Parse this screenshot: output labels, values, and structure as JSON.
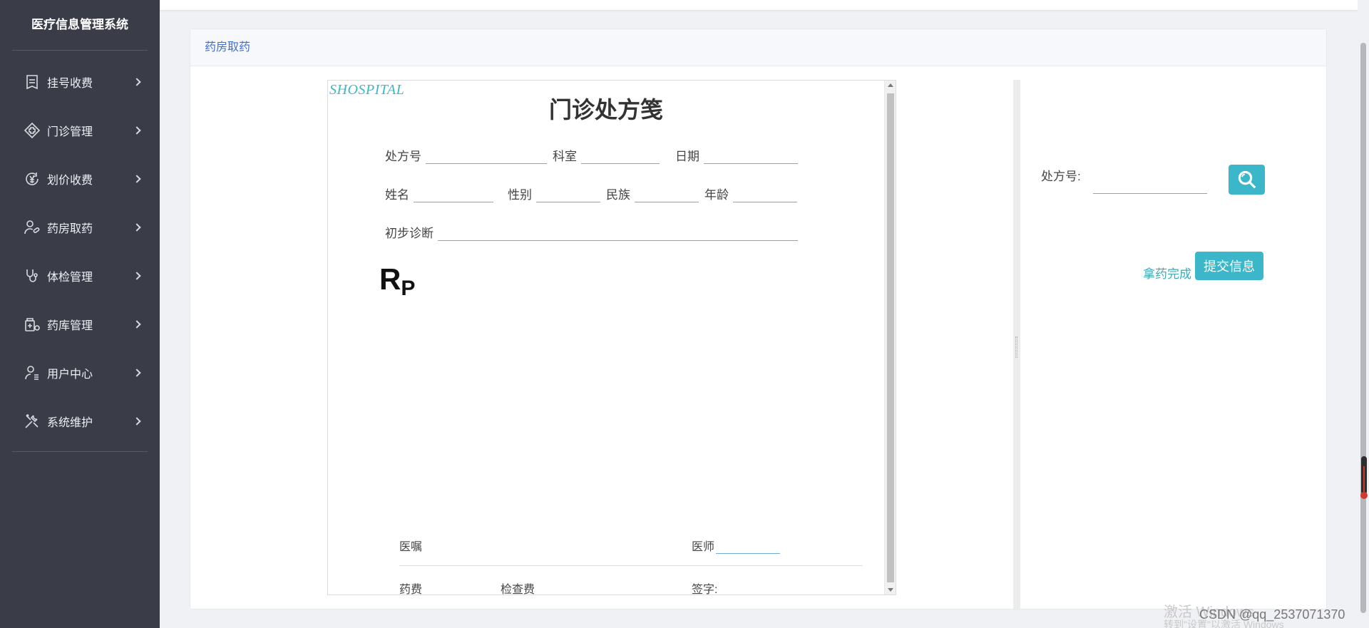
{
  "app": {
    "title": "医疗信息管理系统"
  },
  "sidebar": {
    "items": [
      {
        "label": "挂号收费",
        "icon": "register-fee-icon"
      },
      {
        "label": "门诊管理",
        "icon": "outpatient-icon"
      },
      {
        "label": "划价收费",
        "icon": "pricing-fee-icon"
      },
      {
        "label": "药房取药",
        "icon": "pharmacy-pickup-icon"
      },
      {
        "label": "体检管理",
        "icon": "stethoscope-icon"
      },
      {
        "label": "药库管理",
        "icon": "drug-storage-icon"
      },
      {
        "label": "用户中心",
        "icon": "user-icon"
      },
      {
        "label": "系统维护",
        "icon": "tools-icon"
      }
    ]
  },
  "panel": {
    "title": "药房取药"
  },
  "prescription": {
    "logo": "SHOSPITAL",
    "title": "门诊处方笺",
    "fields": {
      "rx_no": "处方号",
      "department": "科室",
      "date": "日期",
      "name": "姓名",
      "gender": "性别",
      "ethnicity": "民族",
      "age": "年龄",
      "diagnosis": "初步诊断"
    },
    "rp": "R",
    "rp_sub": "P",
    "footer": {
      "advice": "医嘱",
      "doctor": "医师",
      "drug_fee": "药费",
      "exam_fee": "检查费",
      "signature": "签字:"
    }
  },
  "right": {
    "rx_label": "处方号:",
    "rx_value": "",
    "done_label": "拿药完成",
    "submit_label": "提交信息"
  },
  "watermark": {
    "activate": "激活 Windows",
    "activate_sub": "转到\"设置\"以激活 Windows",
    "csdn": "CSDN @qq_2537071370"
  },
  "colors": {
    "sidebar_bg": "#3a3d47",
    "accent": "#3cb7c9",
    "title_blue": "#3f6fd0"
  }
}
